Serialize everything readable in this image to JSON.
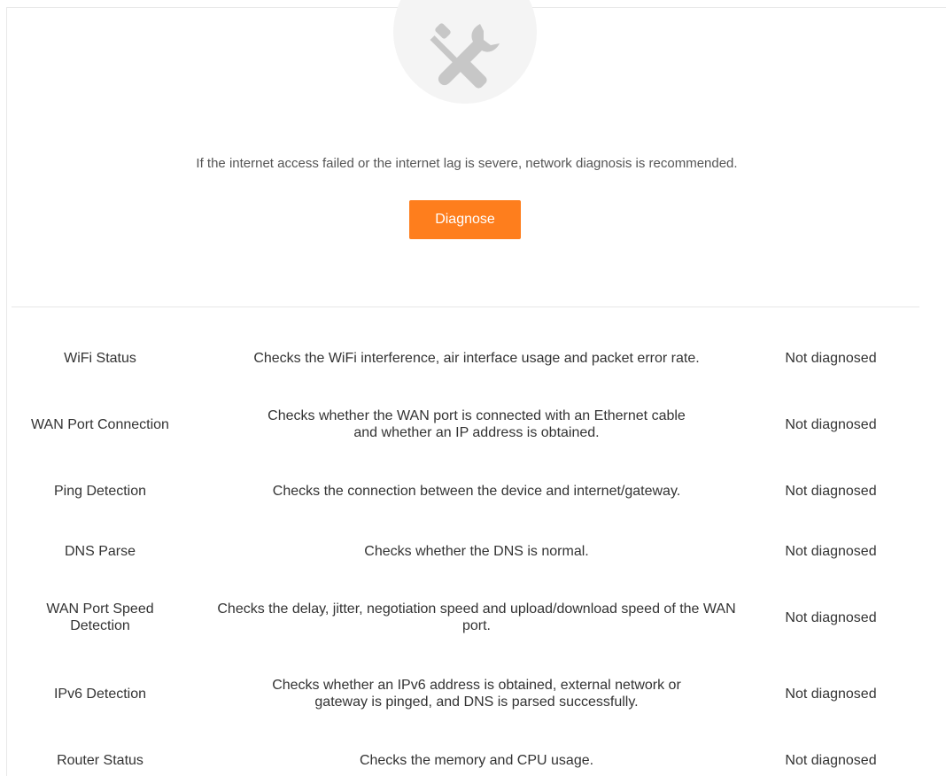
{
  "intro_text": "If the internet access failed or the internet lag is severe, network diagnosis is recommended.",
  "diagnose_label": "Diagnose",
  "colors": {
    "accent": "#fe7e1d",
    "icon_circle": "#f4f4f4",
    "icon": "#c7c7c7"
  },
  "icon": "wrench-screwdriver-icon",
  "items": [
    {
      "name": "WiFi Status",
      "desc": "Checks the WiFi interference, air interface usage and packet error rate.",
      "status": "Not diagnosed"
    },
    {
      "name": "WAN Port Connection",
      "desc": "Checks whether the WAN port is connected with an Ethernet cable and whether an IP address is obtained.",
      "status": "Not diagnosed"
    },
    {
      "name": "Ping Detection",
      "desc": "Checks the connection between the device and internet/gateway.",
      "status": "Not diagnosed"
    },
    {
      "name": "DNS Parse",
      "desc": "Checks whether the DNS is normal.",
      "status": "Not diagnosed"
    },
    {
      "name": "WAN Port Speed Detection",
      "desc": "Checks the delay, jitter, negotiation speed and upload/download speed of the WAN port.",
      "status": "Not diagnosed"
    },
    {
      "name": "IPv6 Detection",
      "desc": "Checks whether an IPv6 address is obtained, external network or gateway is pinged, and DNS is parsed successfully.",
      "status": "Not diagnosed"
    },
    {
      "name": "Router Status",
      "desc": "Checks the memory and CPU usage.",
      "status": "Not diagnosed"
    }
  ]
}
